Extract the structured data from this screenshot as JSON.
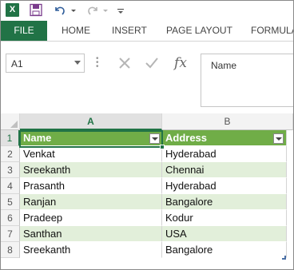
{
  "qat": {
    "app_icon_letter": "X",
    "icons": [
      "excel-icon",
      "save-icon",
      "undo-icon",
      "redo-icon",
      "customize-icon"
    ]
  },
  "ribbon": {
    "tabs": [
      {
        "label": "FILE"
      },
      {
        "label": "HOME"
      },
      {
        "label": "INSERT"
      },
      {
        "label": "PAGE LAYOUT"
      },
      {
        "label": "FORMULA"
      }
    ]
  },
  "formula_bar": {
    "name_box": "A1",
    "fx_label": "fx",
    "content": "Name"
  },
  "grid": {
    "columns": [
      "A",
      "B"
    ],
    "rows": [
      "1",
      "2",
      "3",
      "4",
      "5",
      "6",
      "7",
      "8"
    ],
    "header": {
      "a": "Name",
      "b": "Address"
    },
    "data": [
      {
        "a": "Venkat",
        "b": "Hyderabad"
      },
      {
        "a": "Sreekanth",
        "b": "Chennai"
      },
      {
        "a": "Prasanth",
        "b": "Hyderabad"
      },
      {
        "a": "Ranjan",
        "b": "Bangalore"
      },
      {
        "a": "Pradeep",
        "b": "Kodur"
      },
      {
        "a": "Santhan",
        "b": "USA"
      },
      {
        "a": "Sreekanth",
        "b": "Bangalore"
      }
    ]
  },
  "colors": {
    "accent": "#217346",
    "table_header": "#70ad47",
    "table_band": "#e2efda"
  }
}
